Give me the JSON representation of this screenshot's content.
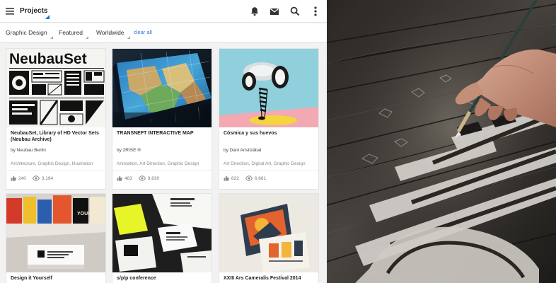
{
  "header": {
    "title": "Projects",
    "icons": [
      "menu-icon",
      "bell-icon",
      "mail-icon",
      "search-icon",
      "more-vert-icon"
    ]
  },
  "filters": {
    "items": [
      "Graphic Design",
      "Featured",
      "Worldwide"
    ],
    "clear_label": "clear all"
  },
  "projects": [
    {
      "title": "NeubauSet, Library of HD Vector Sets (Neubau Archive)",
      "thumb_text": "NeubauSet",
      "author": "by Neubau Berlin",
      "fields": "Architecture, Graphic Design, Illustration",
      "appreciations": "240",
      "views": "3,194"
    },
    {
      "title": "TRANSNEFT INTERACTIVE MAP",
      "author": "by 2RISE ®",
      "fields": "Animation, Art Direction, Graphic Design",
      "appreciations": "483",
      "views": "9,830"
    },
    {
      "title": "Cósmica y sus huevos",
      "author": "by Dani Aristizábal",
      "fields": "Art Direction, Digital Art, Graphic Design",
      "appreciations": "822",
      "views": "6,661"
    },
    {
      "title": "Design it Yourself",
      "thumb_text": "YOURSELF"
    },
    {
      "title": "s/p/p conference"
    },
    {
      "title": "XXIII Ars Cameralis Festival 2014"
    }
  ],
  "colors": {
    "accent": "#1e6bd6",
    "link": "#2a6fd6",
    "background": "#f2f2f2"
  }
}
